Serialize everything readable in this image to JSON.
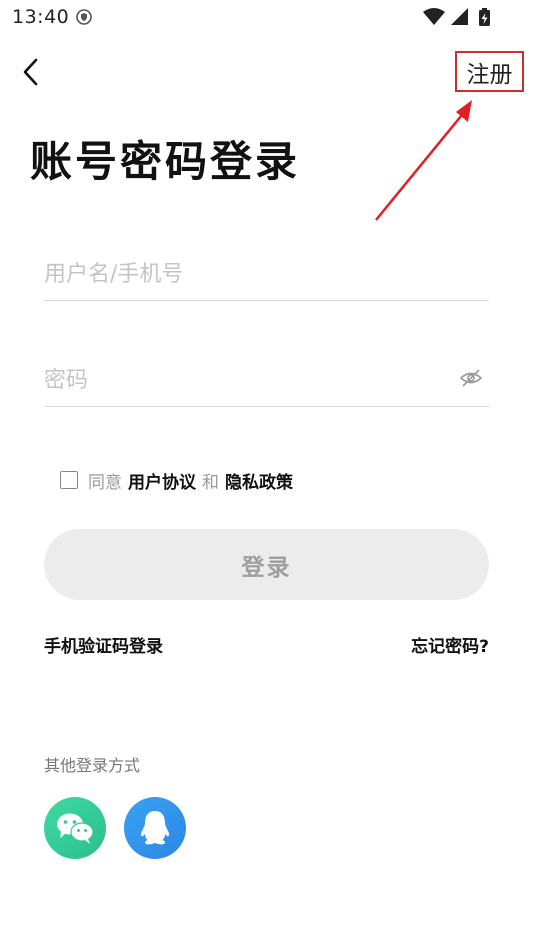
{
  "status_bar": {
    "time": "13:40",
    "icons": [
      "shield-icon",
      "wifi-icon",
      "signal-icon",
      "battery-icon"
    ]
  },
  "nav": {
    "back_icon": "chevron-left-icon",
    "register_label": "注册"
  },
  "annotation": {
    "highlight_color": "#c9302c",
    "arrow_color": "#e02020"
  },
  "page": {
    "title": "账号密码登录"
  },
  "form": {
    "username": {
      "value": "",
      "placeholder": "用户名/手机号"
    },
    "password": {
      "value": "",
      "placeholder": "密码",
      "toggle_icon": "eye-hidden-icon"
    }
  },
  "agreement": {
    "checked": false,
    "prefix": "同意",
    "user_agreement": "用户协议",
    "conjunction": "和",
    "privacy_policy": "隐私政策"
  },
  "login_button": {
    "label": "登录"
  },
  "links": {
    "sms_login": "手机验证码登录",
    "forgot_password": "忘记密码?"
  },
  "other_login": {
    "label": "其他登录方式",
    "methods": [
      {
        "name": "wechat",
        "icon": "wechat-icon",
        "color": "#34c997"
      },
      {
        "name": "qq",
        "icon": "qq-icon",
        "color": "#3496ec"
      }
    ]
  }
}
